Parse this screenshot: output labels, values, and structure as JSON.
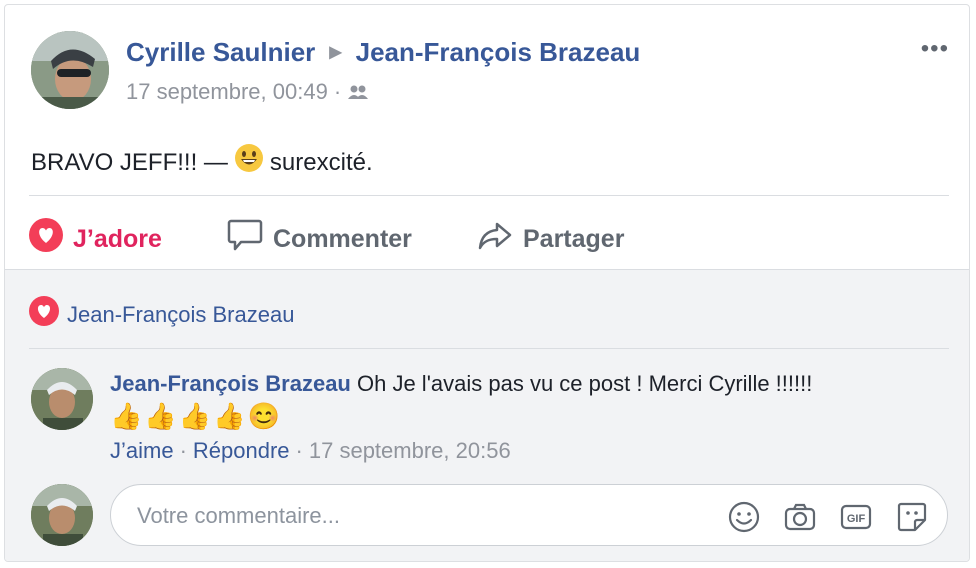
{
  "post": {
    "author": "Cyrille Saulnier",
    "target": "Jean-François Brazeau",
    "timestamp": "17 septembre, 00:49",
    "dot": "·",
    "audience_icon": "friends-icon",
    "more_label": "•••",
    "text_before": "BRAVO JEFF!!! —",
    "feeling": "surexcité."
  },
  "actions": {
    "love": "J’adore",
    "comment": "Commenter",
    "share": "Partager"
  },
  "reactions": {
    "names": "Jean-François Brazeau"
  },
  "comment": {
    "author": "Jean-François Brazeau",
    "text": "Oh Je l'avais pas vu ce post ! Merci Cyrille !!!!!!",
    "emojis": "👍👍👍👍😊",
    "like": "J’aime",
    "reply": "Répondre",
    "sep": "·",
    "timestamp": "17 septembre, 20:56"
  },
  "composer": {
    "placeholder": "Votre commentaire..."
  },
  "colors": {
    "link": "#385898",
    "love": "#e0245e",
    "muted": "#90949c"
  }
}
